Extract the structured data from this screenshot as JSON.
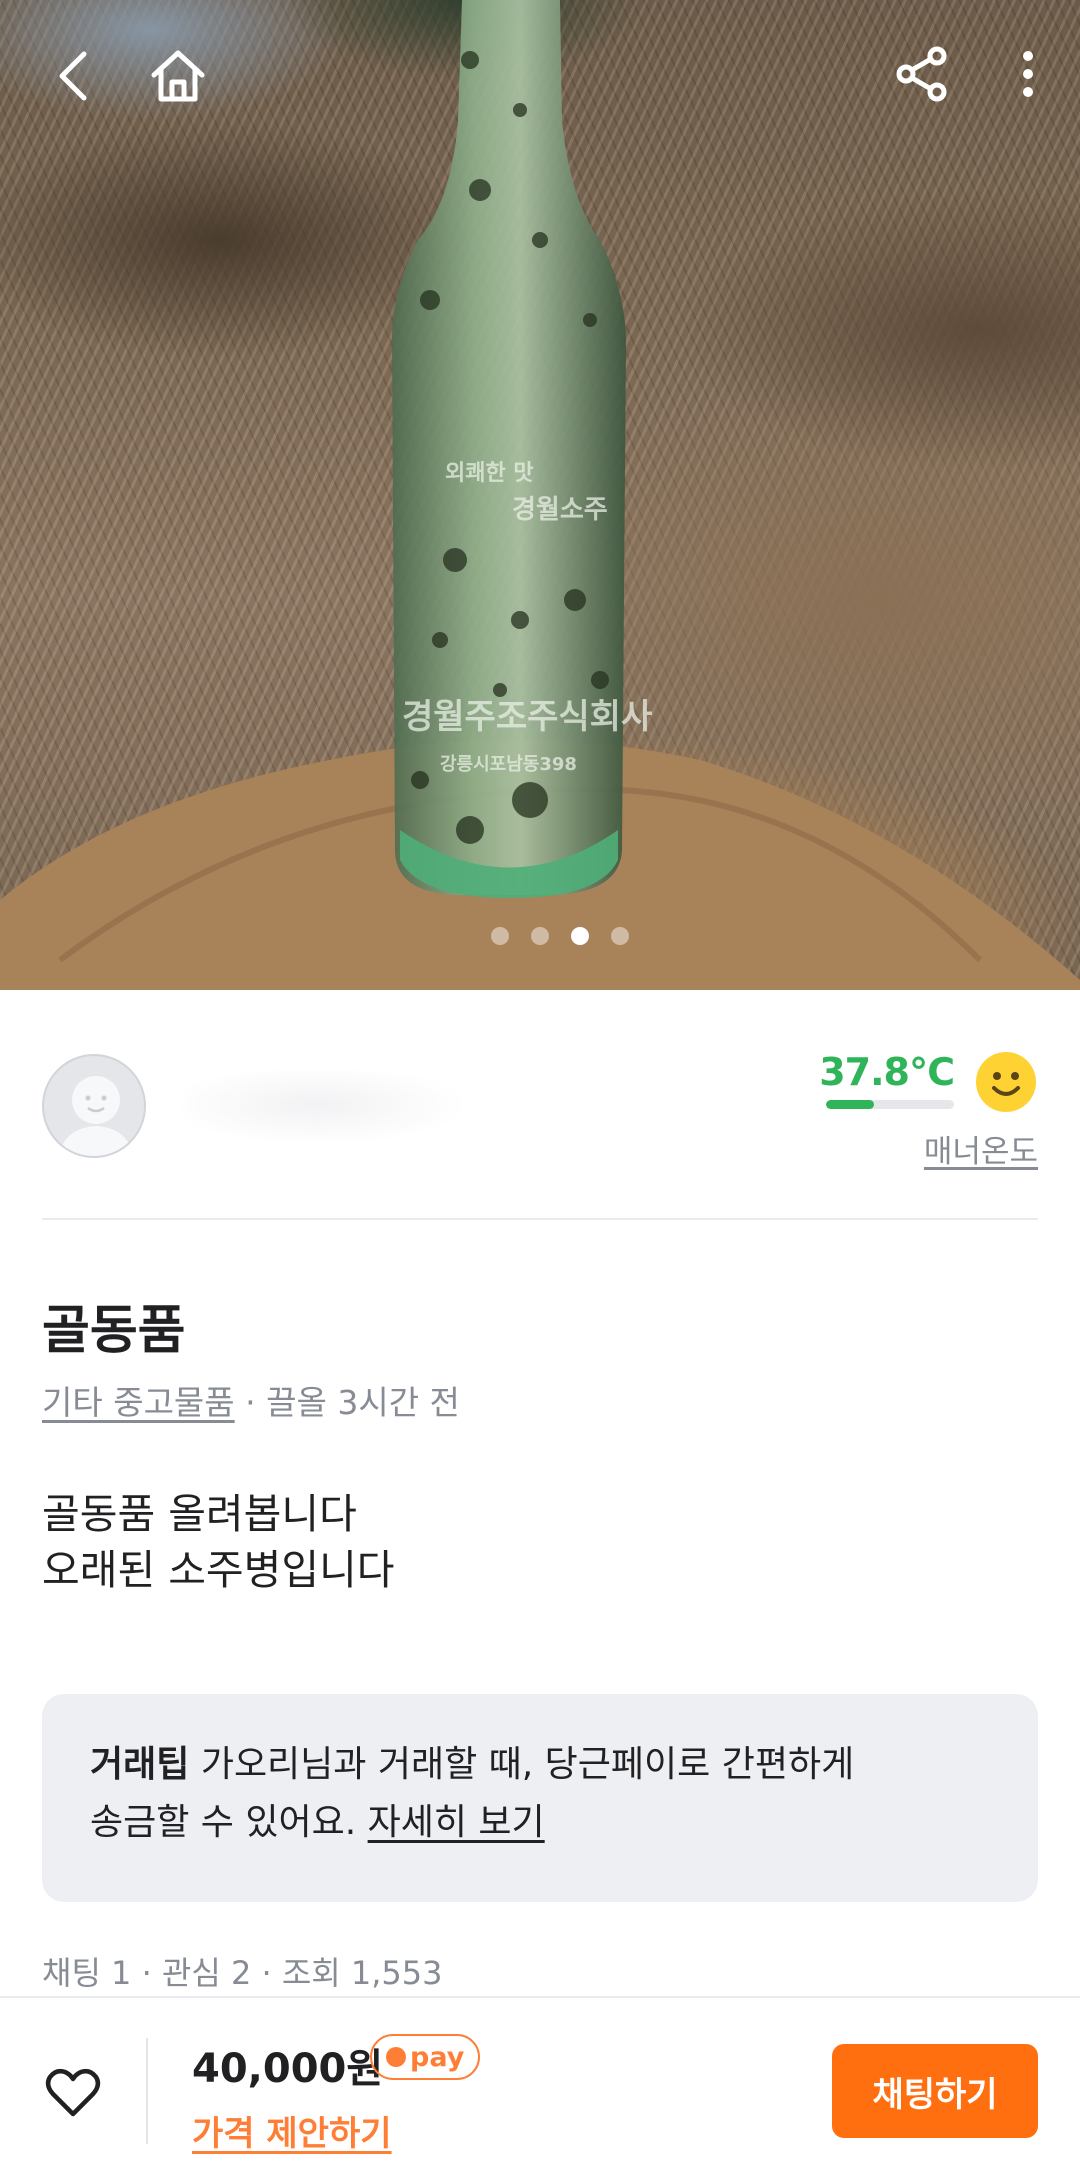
{
  "post": {
    "title": "골동품",
    "category": "기타 중고물품",
    "time_text": " · 끌올 3시간 전",
    "description_lines": [
      "골동품 올려봅니다",
      "오래된 소주병입니다"
    ],
    "bottle_text": [
      "외쾌한 맛",
      "경월소주",
      "경월주조주식회사",
      "강릉시포남동398"
    ]
  },
  "gallery": {
    "image_count": 4,
    "active_index": 2
  },
  "seller": {
    "manner_temperature": "37.8℃",
    "manner_label": "매너온도",
    "temperature_value": 37.8
  },
  "tip": {
    "bold": "거래팁",
    "line1": " 가오리님과 거래할 때, 당근페이로 간편하게",
    "line2": "송금할 수 있어요. ",
    "link": "자세히 보기"
  },
  "stats": "채팅 1 · 관심 2 · 조회 1,553",
  "bottom_bar": {
    "price": "40,000원",
    "pay_badge": "pay",
    "offer_label": "가격 제안하기",
    "chat_button": "채팅하기"
  },
  "colors": {
    "brand_orange": "#ff6f0f",
    "manner_green": "#2fb45a",
    "muted_text": "#868b94"
  },
  "icons": [
    "back-icon",
    "home-icon",
    "share-icon",
    "more-icon",
    "heart-icon",
    "smile-face-icon"
  ]
}
